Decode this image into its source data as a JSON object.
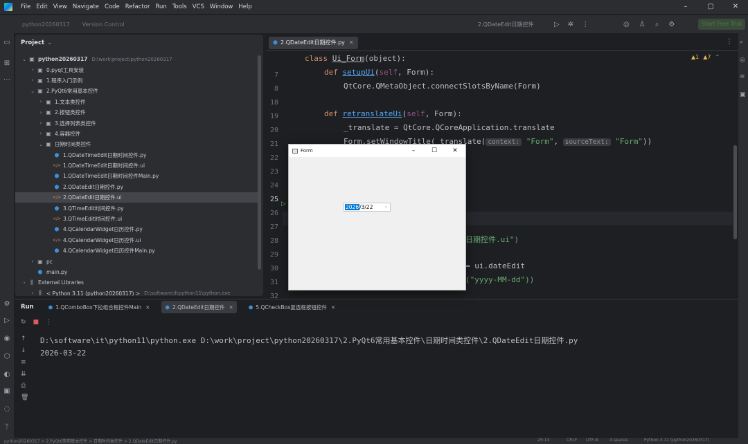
{
  "menubar": {
    "items": [
      "File",
      "Edit",
      "View",
      "Navigate",
      "Code",
      "Refactor",
      "Run",
      "Tools",
      "VCS",
      "Window",
      "Help"
    ]
  },
  "toolbar": {
    "project_name": "python20260317",
    "branch": "Version Control",
    "run_config": "2.QDateEdit日期控件",
    "trial_button": "Start Free Trial"
  },
  "project_panel": {
    "title": "Project",
    "tree": [
      {
        "label": "python20260317",
        "extra": "D:\\work\\project\\python20260317",
        "type": "folder",
        "arrow": "expanded"
      },
      {
        "label": "0.pyqt工具安装",
        "type": "folder",
        "arrow": "collapsed"
      },
      {
        "label": "1.程序入门示例",
        "type": "folder",
        "arrow": "collapsed"
      },
      {
        "label": "2.PyQt6常用基本控件",
        "type": "folder",
        "arrow": "expanded"
      },
      {
        "label": "1.文本类控件",
        "type": "folder",
        "arrow": "collapsed"
      },
      {
        "label": "2.按钮类控件",
        "type": "folder",
        "arrow": "collapsed"
      },
      {
        "label": "3.选择列表类控件",
        "type": "folder",
        "arrow": "collapsed"
      },
      {
        "label": "4.容器控件",
        "type": "folder",
        "arrow": "collapsed"
      },
      {
        "label": "日期时间类控件",
        "type": "folder",
        "arrow": "expanded"
      },
      {
        "label": "1.QDateTimeEdit日期时间控件.py",
        "type": "py"
      },
      {
        "label": "1.QDateTimeEdit日期时间控件.ui",
        "type": "ui"
      },
      {
        "label": "1.QDateTimeEdit日期时间控件Main.py",
        "type": "py"
      },
      {
        "label": "2.QDateEdit日期控件.py",
        "type": "py"
      },
      {
        "label": "2.QDateEdit日期控件.ui",
        "type": "ui",
        "selected": true
      },
      {
        "label": "3.QTimeEdit时间控件.py",
        "type": "py"
      },
      {
        "label": "3.QTimeEdit时间控件.ui",
        "type": "ui"
      },
      {
        "label": "4.QCalendarWidget日历控件.py",
        "type": "py"
      },
      {
        "label": "4.QCalendarWidget日历控件.ui",
        "type": "ui"
      },
      {
        "label": "4.QCalendarWidget日历控件Main.py",
        "type": "py"
      },
      {
        "label": "pc",
        "type": "folder",
        "arrow": "collapsed"
      },
      {
        "label": "main.py",
        "type": "py"
      },
      {
        "label": "External Libraries",
        "type": "lib",
        "arrow": "collapsed"
      },
      {
        "label": "< Python 3.11 (python20260317) >",
        "extra": "D:\\software\\it\\python11\\python.exe",
        "type": "lib",
        "arrow": "collapsed"
      }
    ]
  },
  "editor": {
    "tab_label": "2.QDateEdit日期控件.py",
    "inspection": {
      "warnings": "▲1",
      "weak": "▲7"
    },
    "line_numbers": [
      "7",
      "8",
      "18",
      "19",
      "20",
      "21",
      "22",
      "23",
      "24",
      "25",
      "26",
      "27",
      "28",
      "29",
      "30",
      "31",
      "32"
    ],
    "lines": {
      "l7_kw": "class ",
      "l7_name": "Ui_Form",
      "l7_rest": "(object):",
      "l8_kw": "def ",
      "l8_fn": "setupUi",
      "l8_open": "(",
      "l8_self": "self",
      "l8_rest": ", Form):",
      "l18": "QtCore.QMetaObject.connectSlotsByName(Form)",
      "l20_kw": "def ",
      "l20_fn": "retranslateUi",
      "l20_open": "(",
      "l20_self": "self",
      "l20_rest": ", Form):",
      "l21": "_translate = QtCore.QCoreApplication.translate",
      "l22_pre": "Form.setWindowTitle(_translate(",
      "l22_hint1": "context:",
      "l22_str1": "\"Form\"",
      "l22_comma": ", ",
      "l22_hint2": "sourceText:",
      "l22_str2": "\"Form\"",
      "l22_end": "))",
      "l29": "日期控件.ui\")",
      "l31": "= ui.dateEdit",
      "l32": "(\"yyyy-MM-dd\"))"
    }
  },
  "form_window": {
    "title": "Form",
    "date_selected": "2026",
    "date_rest": "/3/22"
  },
  "run_panel": {
    "title": "Run",
    "tabs": [
      {
        "label": "1.QComboBox下拉组合框控件Main",
        "active": false
      },
      {
        "label": "2.QDateEdit日期控件",
        "active": true
      },
      {
        "label": "5.QCheckBox复选框按钮控件",
        "active": false
      }
    ],
    "console": [
      "D:\\software\\it\\python11\\python.exe D:\\work\\project\\python20260317\\2.PyQt6常用基本控件\\日期时间类控件\\2.QDateEdit日期控件.py",
      "2026-03-22"
    ]
  },
  "statusbar": {
    "breadcrumb": "python20260317 > 2.PyQt6常用基本控件 > 日期时间类控件 > 2.QDateEdit日期控件.py",
    "position": "25:13",
    "line_sep": "CRLF",
    "encoding": "UTF-8",
    "indent": "4 spaces",
    "interpreter": "Python 3.11 (python20260317)"
  }
}
